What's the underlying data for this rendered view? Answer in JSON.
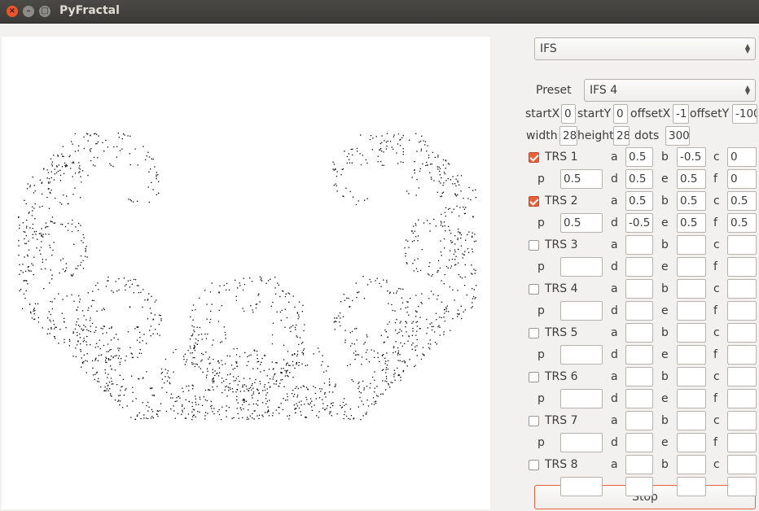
{
  "window": {
    "title": "PyFractal"
  },
  "mode_select": {
    "value": "IFS"
  },
  "preset": {
    "label": "Preset",
    "value": "IFS 4"
  },
  "params": {
    "startX_label": "startX",
    "startX": "0",
    "startY_label": "startY",
    "startY": "0",
    "offsetX_label": "offsetX",
    "offsetX": "-1",
    "offsetY_label": "offsetY",
    "offsetY": "-100",
    "width_label": "width",
    "width": "28",
    "height_label": "height",
    "height": "28",
    "dots_label": "dots",
    "dots": "300"
  },
  "coef_labels": {
    "a": "a",
    "b": "b",
    "c": "c",
    "p": "p",
    "d": "d",
    "e": "e",
    "f": "f"
  },
  "transforms": [
    {
      "label": "TRS 1",
      "checked": true,
      "a": "0.5",
      "b": "-0.5",
      "c": "0",
      "p": "0.5",
      "d": "0.5",
      "e": "0.5",
      "f": "0"
    },
    {
      "label": "TRS 2",
      "checked": true,
      "a": "0.5",
      "b": "0.5",
      "c": "0.5",
      "p": "0.5",
      "d": "-0.5",
      "e": "0.5",
      "f": "0.5"
    },
    {
      "label": "TRS 3",
      "checked": false,
      "a": "",
      "b": "",
      "c": "",
      "p": "",
      "d": "",
      "e": "",
      "f": ""
    },
    {
      "label": "TRS 4",
      "checked": false,
      "a": "",
      "b": "",
      "c": "",
      "p": "",
      "d": "",
      "e": "",
      "f": ""
    },
    {
      "label": "TRS 5",
      "checked": false,
      "a": "",
      "b": "",
      "c": "",
      "p": "",
      "d": "",
      "e": "",
      "f": ""
    },
    {
      "label": "TRS 6",
      "checked": false,
      "a": "",
      "b": "",
      "c": "",
      "p": "",
      "d": "",
      "e": "",
      "f": ""
    },
    {
      "label": "TRS 7",
      "checked": false,
      "a": "",
      "b": "",
      "c": "",
      "p": "",
      "d": "",
      "e": "",
      "f": ""
    },
    {
      "label": "TRS 8",
      "checked": false,
      "a": "",
      "b": "",
      "c": "",
      "p": "",
      "d": "",
      "e": "",
      "f": ""
    }
  ],
  "stop_button": {
    "label": "Stop"
  },
  "colors": {
    "accent": "#e8613b",
    "dots": "#000000"
  }
}
